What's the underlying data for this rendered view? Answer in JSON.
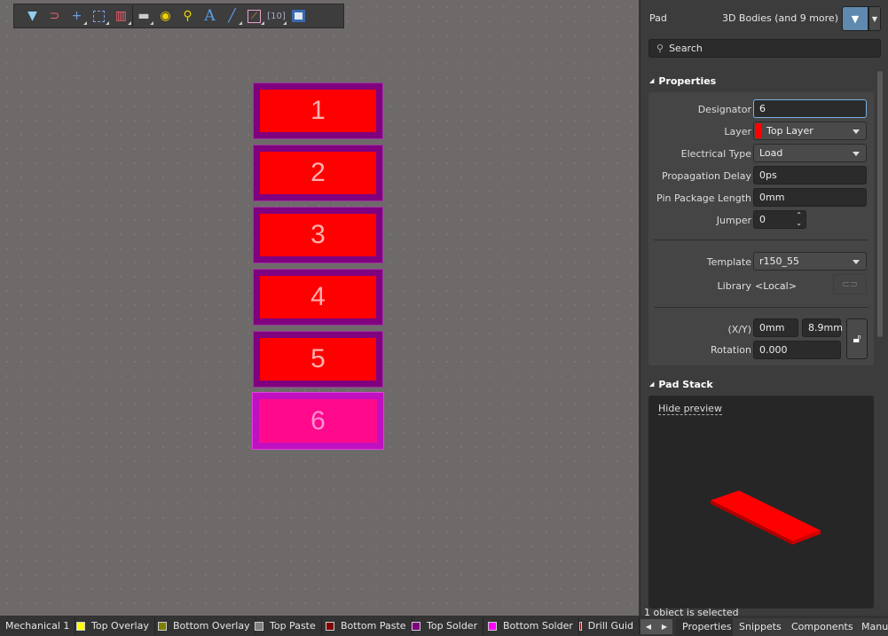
{
  "toolbar": {
    "icons": [
      "filter-icon",
      "snap-magnet-icon",
      "crosshair-icon",
      "select-rect-icon",
      "align-icon",
      "component-icon",
      "pad-icon",
      "via-icon",
      "text-icon",
      "line-icon",
      "route-icon",
      "dimension-icon",
      "region-icon"
    ]
  },
  "canvas": {
    "pads": [
      {
        "label": "1",
        "selected": false
      },
      {
        "label": "2",
        "selected": false
      },
      {
        "label": "3",
        "selected": false
      },
      {
        "label": "4",
        "selected": false
      },
      {
        "label": "5",
        "selected": false
      },
      {
        "label": "6",
        "selected": true
      }
    ]
  },
  "panel": {
    "object_type": "Pad",
    "filter_text": "3D Bodies (and 9 more)",
    "search_placeholder": "Search",
    "properties_title": "Properties",
    "designator_label": "Designator",
    "designator": "6",
    "layer_label": "Layer",
    "layer": "Top Layer",
    "layer_color": "#ff0000",
    "electrical_type_label": "Electrical Type",
    "electrical_type": "Load",
    "propagation_delay_label": "Propagation Delay",
    "propagation_delay": "0ps",
    "pin_package_length_label": "Pin Package Length",
    "pin_package_length": "0mm",
    "jumper_label": "Jumper",
    "jumper": "0",
    "template_label": "Template",
    "template": "r150_55",
    "library_label": "Library",
    "library": "<Local>",
    "xy_label": "(X/Y)",
    "x": "0mm",
    "y": "8.9mm",
    "rotation_label": "Rotation",
    "rotation": "0.000",
    "pad_stack_title": "Pad Stack",
    "hide_preview": "Hide preview",
    "status": "1 object is selected"
  },
  "layer_tabs": [
    {
      "name": "Mechanical 1",
      "color": "#3c3c3c"
    },
    {
      "name": "Top Overlay",
      "color": "#ffff00"
    },
    {
      "name": "Bottom Overlay",
      "color": "#808000"
    },
    {
      "name": "Top Paste",
      "color": "#808080"
    },
    {
      "name": "Bottom Paste",
      "color": "#800000"
    },
    {
      "name": "Top Solder",
      "color": "#800080"
    },
    {
      "name": "Bottom Solder",
      "color": "#ff00ff"
    },
    {
      "name": "Drill Guid",
      "color": "#800000"
    }
  ],
  "panel_tabs": [
    "Properties",
    "Snippets",
    "Components",
    "Manu"
  ]
}
